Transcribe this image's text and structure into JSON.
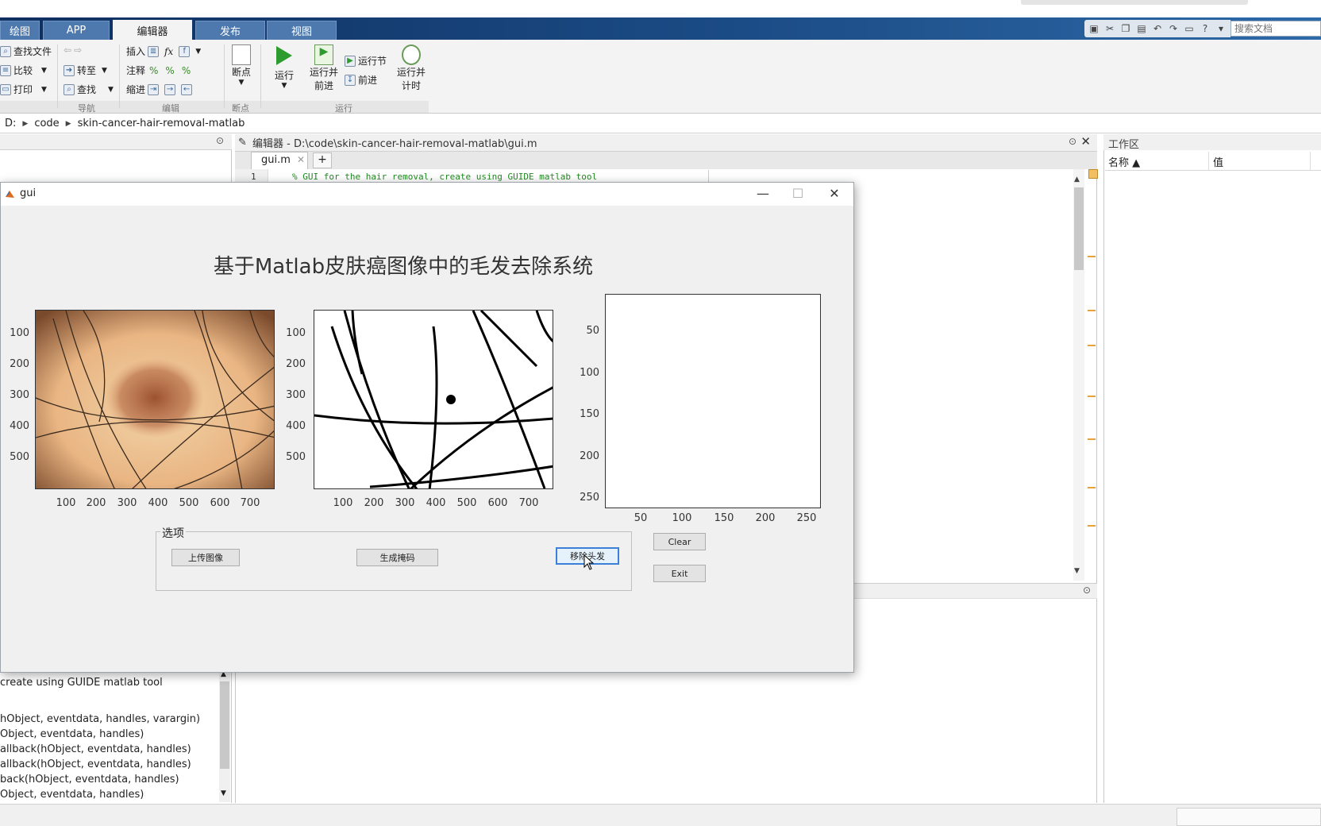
{
  "ribbon": {
    "tabs": [
      {
        "label": "绘图"
      },
      {
        "label": "APP"
      },
      {
        "label": "编辑器"
      },
      {
        "label": "发布"
      },
      {
        "label": "视图"
      }
    ],
    "search_placeholder": "搜索文档",
    "file": {
      "find_files": "查找文件",
      "compare": "比较",
      "print": "打印"
    },
    "nav": {
      "goto": "转至",
      "find": "查找",
      "group": "导航"
    },
    "edit": {
      "insert": "插入",
      "comment": "注释",
      "indent": "缩进",
      "fx": "fx",
      "group": "编辑"
    },
    "breakpoints": {
      "label": "断点",
      "group": "断点"
    },
    "run": {
      "run": "运行",
      "run_advance_1": "运行并",
      "run_advance_2": "前进",
      "run_section": "运行节",
      "advance": "前进",
      "run_time_1": "运行并",
      "run_time_2": "计时",
      "group": "运行"
    }
  },
  "address": {
    "drive": "D:",
    "folder1": "code",
    "folder2": "skin-cancer-hair-removal-matlab"
  },
  "editor": {
    "header": "编辑器 - D:\\code\\skin-cancer-hair-removal-matlab\\gui.m",
    "tab": "gui.m",
    "tab_add": "+",
    "line_number": "1",
    "code_line": "% GUI for the hair removal, create using GUIDE matlab tool"
  },
  "workspace": {
    "title": "工作区",
    "col_name": "名称 ▲",
    "col_value": "值"
  },
  "function_list": [
    "create using GUIDE matlab tool",
    "",
    "hObject, eventdata, handles, varargin)",
    "Object, eventdata, handles)",
    "allback(hObject, eventdata, handles)",
    "allback(hObject, eventdata, handles)",
    "back(hObject, eventdata, handles)",
    "Object, eventdata, handles)"
  ],
  "gui": {
    "title": "gui",
    "heading": "基于Matlab皮肤癌图像中的毛发去除系统",
    "axes1": {
      "yticks": [
        "100",
        "200",
        "300",
        "400",
        "500"
      ],
      "xticks": [
        "100",
        "200",
        "300",
        "400",
        "500",
        "600",
        "700"
      ]
    },
    "axes2": {
      "yticks": [
        "100",
        "200",
        "300",
        "400",
        "500"
      ],
      "xticks": [
        "100",
        "200",
        "300",
        "400",
        "500",
        "600",
        "700"
      ]
    },
    "axes3": {
      "yticks": [
        "50",
        "100",
        "150",
        "200",
        "250"
      ],
      "xticks": [
        "50",
        "100",
        "150",
        "200",
        "250"
      ]
    },
    "options_panel": "选项",
    "btn_upload": "上传图像",
    "btn_mask": "生成掩码",
    "btn_remove": "移除头发",
    "btn_clear": "Clear",
    "btn_exit": "Exit"
  },
  "colors": {
    "accent": "#3c7fd9",
    "ribbon_tab": "#4d79ae",
    "code_comment": "#228b22"
  }
}
